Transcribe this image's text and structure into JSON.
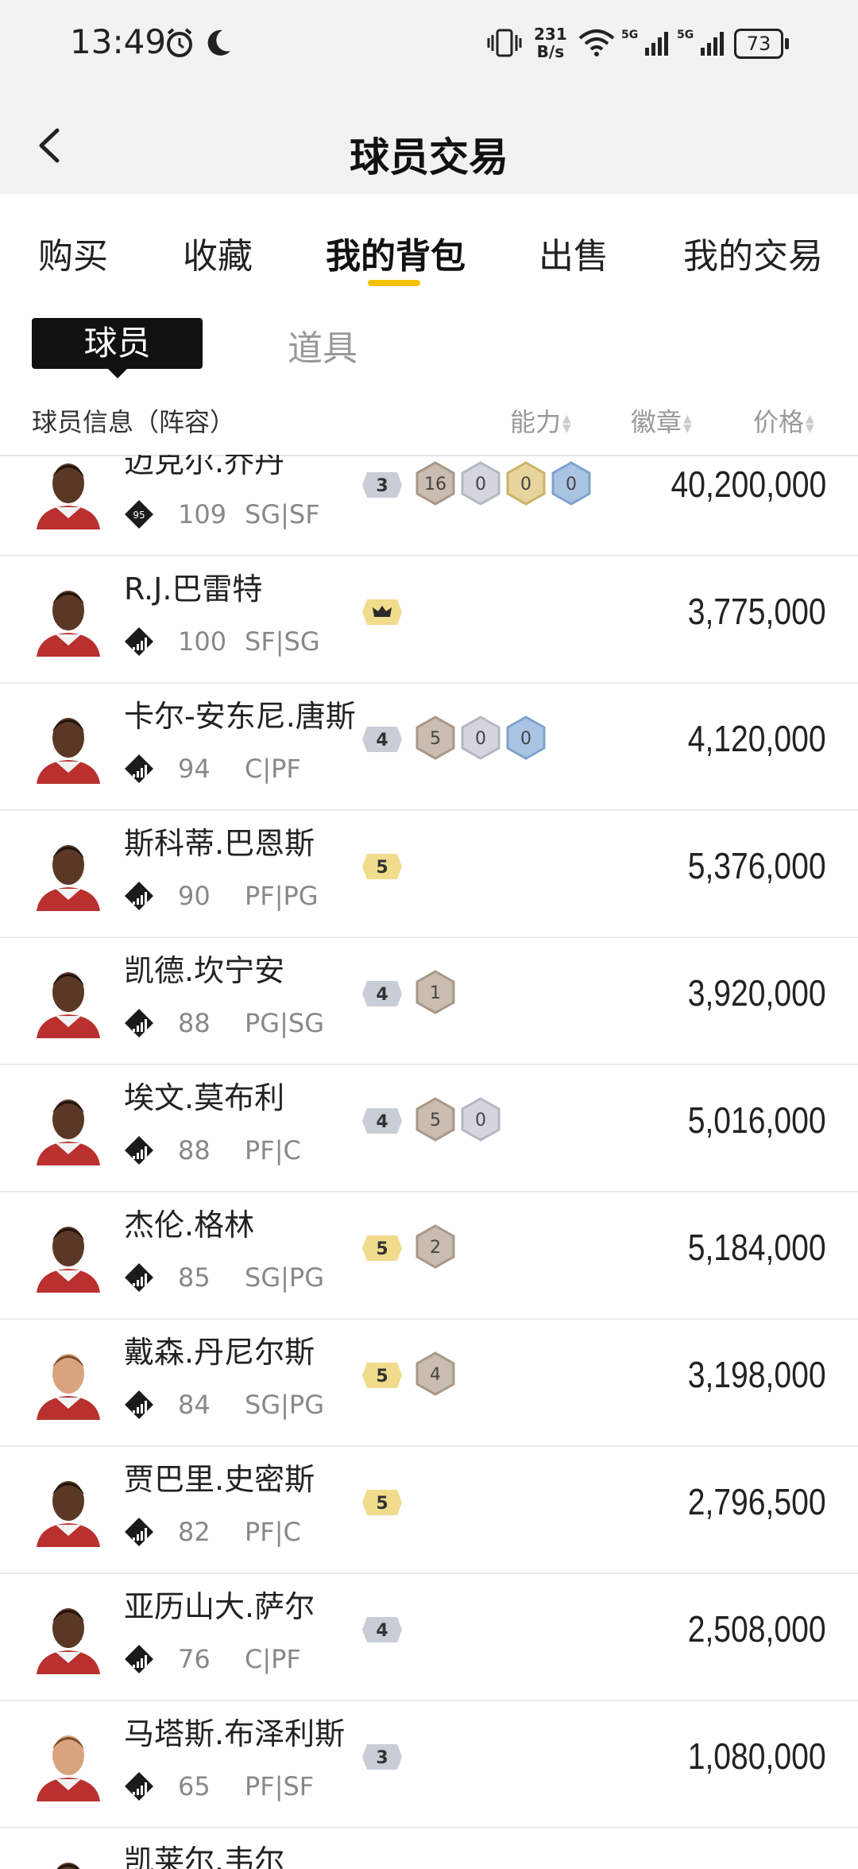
{
  "status_bar": {
    "time": "13:49",
    "net_speed_top": "231",
    "net_speed_bottom": "B/s",
    "battery": "73",
    "icons": [
      "alarm-icon",
      "moon-icon",
      "vibrate-icon",
      "wifi-icon",
      "signal-5g-icon",
      "signal-5g-icon"
    ]
  },
  "header": {
    "title": "球员交易",
    "back_icon": "chevron-left-icon"
  },
  "tabs": [
    {
      "label": "购买"
    },
    {
      "label": "收藏"
    },
    {
      "label": "我的背包",
      "active": true
    },
    {
      "label": "出售"
    },
    {
      "label": "我的交易"
    }
  ],
  "subtabs": [
    {
      "label": "球员",
      "active": true
    },
    {
      "label": "道具"
    }
  ],
  "columns": {
    "info": "球员信息（阵容）",
    "ability": "能力",
    "badge": "徽章",
    "price": "价格"
  },
  "colors": {
    "accent": "#f2c200",
    "tag_gold": "#f0dc8c",
    "tag_silver": "#c9cdd6",
    "badge_bronze": "#c9bcb0",
    "badge_silver": "#d3d6dd",
    "badge_gold": "#e6d49c",
    "badge_blue": "#a9c4e3"
  },
  "players": [
    {
      "name": "迈克尔.乔丹",
      "ovr": "109",
      "pos": "SG|SF",
      "price": "40,200,000",
      "tag": "3",
      "tag_color": "silver",
      "badges": [
        {
          "n": "16",
          "c": "bronze"
        },
        {
          "n": "0",
          "c": "silver"
        },
        {
          "n": "0",
          "c": "gold"
        },
        {
          "n": "0",
          "c": "blue"
        }
      ],
      "rank": "95"
    },
    {
      "name": "R.J.巴雷特",
      "ovr": "100",
      "pos": "SF|SG",
      "price": "3,775,000",
      "tag": "crown",
      "tag_color": "gold",
      "badges": []
    },
    {
      "name": "卡尔-安东尼.唐斯",
      "ovr": "94",
      "pos": "C|PF",
      "price": "4,120,000",
      "tag": "4",
      "tag_color": "silver",
      "badges": [
        {
          "n": "5",
          "c": "bronze"
        },
        {
          "n": "0",
          "c": "silver"
        },
        {
          "n": "0",
          "c": "blue"
        }
      ]
    },
    {
      "name": "斯科蒂.巴恩斯",
      "ovr": "90",
      "pos": "PF|PG",
      "price": "5,376,000",
      "tag": "5",
      "tag_color": "gold",
      "badges": []
    },
    {
      "name": "凯德.坎宁安",
      "ovr": "88",
      "pos": "PG|SG",
      "price": "3,920,000",
      "tag": "4",
      "tag_color": "silver",
      "badges": [
        {
          "n": "1",
          "c": "bronze"
        }
      ]
    },
    {
      "name": "埃文.莫布利",
      "ovr": "88",
      "pos": "PF|C",
      "price": "5,016,000",
      "tag": "4",
      "tag_color": "silver",
      "badges": [
        {
          "n": "5",
          "c": "bronze"
        },
        {
          "n": "0",
          "c": "silver"
        }
      ]
    },
    {
      "name": "杰伦.格林",
      "ovr": "85",
      "pos": "SG|PG",
      "price": "5,184,000",
      "tag": "5",
      "tag_color": "gold",
      "badges": [
        {
          "n": "2",
          "c": "bronze"
        }
      ]
    },
    {
      "name": "戴森.丹尼尔斯",
      "ovr": "84",
      "pos": "SG|PG",
      "price": "3,198,000",
      "tag": "5",
      "tag_color": "gold",
      "badges": [
        {
          "n": "4",
          "c": "bronze"
        }
      ]
    },
    {
      "name": "贾巴里.史密斯",
      "ovr": "82",
      "pos": "PF|C",
      "price": "2,796,500",
      "tag": "5",
      "tag_color": "gold",
      "badges": []
    },
    {
      "name": "亚历山大.萨尔",
      "ovr": "76",
      "pos": "C|PF",
      "price": "2,508,000",
      "tag": "4",
      "tag_color": "silver",
      "badges": []
    },
    {
      "name": "马塔斯.布泽利斯",
      "ovr": "65",
      "pos": "PF|SF",
      "price": "1,080,000",
      "tag": "3",
      "tag_color": "silver",
      "badges": []
    },
    {
      "name": "凯莱尔.韦尔",
      "ovr": "",
      "pos": "",
      "price": "",
      "tag": "",
      "tag_color": "silver",
      "badges": []
    }
  ]
}
